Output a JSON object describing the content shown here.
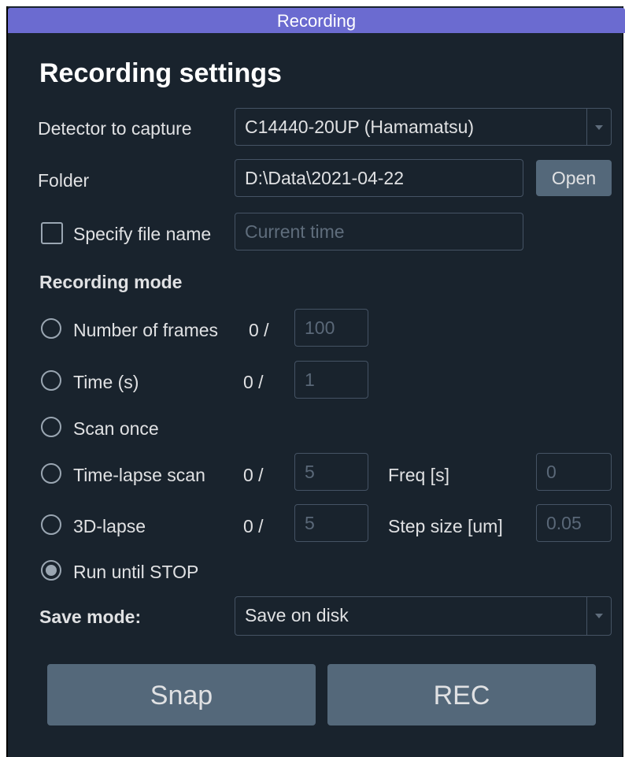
{
  "window": {
    "title": "Recording"
  },
  "settings": {
    "heading": "Recording settings",
    "detector_label": "Detector to capture",
    "detector_value": "C14440-20UP (Hamamatsu)",
    "folder_label": "Folder",
    "folder_value": "D:\\Data\\2021-04-22",
    "open_label": "Open",
    "specify_label": "Specify file name",
    "filename_placeholder": "Current time",
    "mode_heading": "Recording mode",
    "modes": [
      {
        "label": "Number of frames",
        "counter": "0 /",
        "value": "100"
      },
      {
        "label": "Time (s)",
        "counter": "0 /",
        "value": "1"
      },
      {
        "label": "Scan once"
      },
      {
        "label": "Time-lapse scan",
        "counter": "0 /",
        "value": "5",
        "extra_label": "Freq [s]",
        "extra_value": "0"
      },
      {
        "label": "3D-lapse",
        "counter": "0 /",
        "value": "5",
        "extra_label": "Step size [um]",
        "extra_value": "0.05"
      },
      {
        "label": "Run until STOP",
        "checked": true
      }
    ],
    "save_label": "Save mode:",
    "save_value": "Save on disk",
    "snap_label": "Snap",
    "rec_label": "REC"
  },
  "colors": {
    "background": "#19232d",
    "titlebar": "#6b6bd0",
    "button": "#54687a",
    "border": "#455364"
  }
}
